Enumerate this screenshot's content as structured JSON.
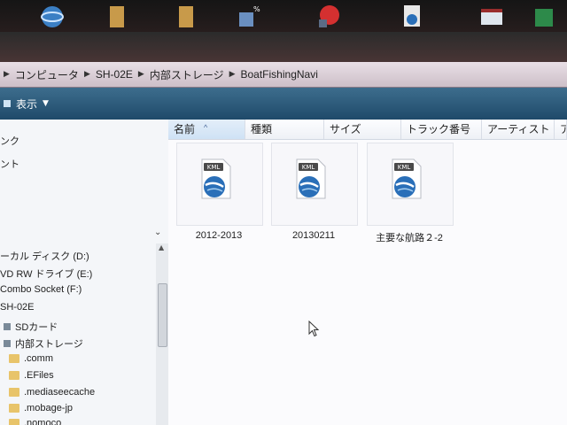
{
  "breadcrumb": [
    "コンピュータ",
    "SH-02E",
    "内部ストレージ",
    "BoatFishingNavi"
  ],
  "toolbar": {
    "view_label": "表示"
  },
  "nav": {
    "items": [
      "ンク",
      "ント",
      "ーカル ディスク (D:)",
      "VD RW ドライブ (E:)",
      "Combo Socket (F:)",
      "SH-02E",
      "SDカード",
      "内部ストレージ",
      ".comm",
      ".EFiles",
      ".mediaseecache",
      ".mobage-jp",
      ".nomoco"
    ]
  },
  "columns": [
    "名前",
    "種類",
    "サイズ",
    "トラック番号",
    "アーティスト",
    "ア"
  ],
  "files": [
    {
      "name": "2012-2013",
      "badge": "KML",
      "icon": "google-earth-kml-icon"
    },
    {
      "name": "20130211",
      "badge": "KML",
      "icon": "google-earth-kml-icon"
    },
    {
      "name": "主要な航路２-2",
      "badge": "KML",
      "icon": "google-earth-kml-icon"
    }
  ],
  "colors": {
    "toolbar": "#2d5a7a",
    "addressbar": "#ddd0d9",
    "kml_globe": "#2a6fb8"
  }
}
